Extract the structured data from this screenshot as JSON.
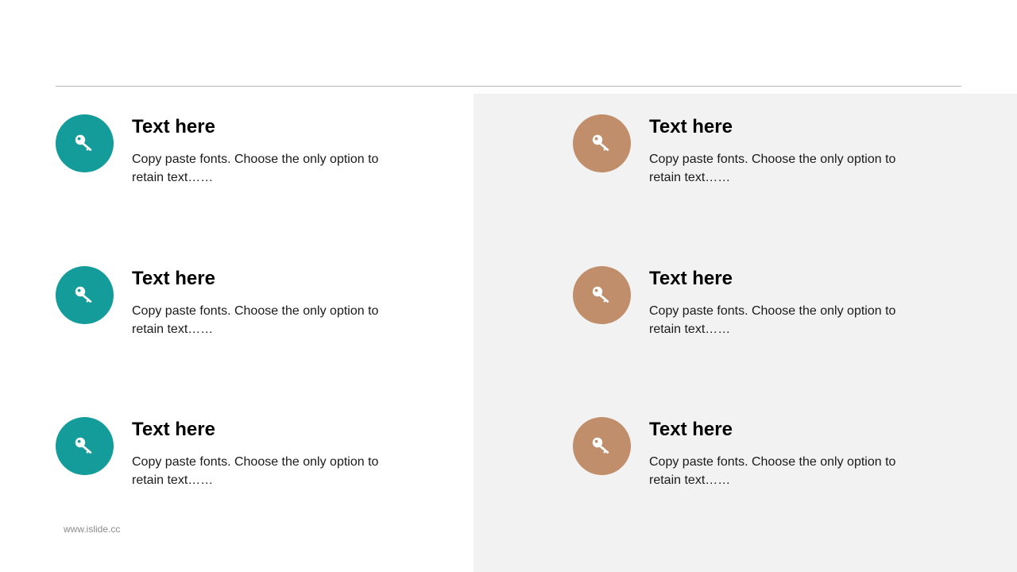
{
  "colors": {
    "teal": "#139c9a",
    "tan": "#c08e6a",
    "panel": "#f2f2f2",
    "rule": "#b3b3b3"
  },
  "left_items": [
    {
      "icon": "key-icon",
      "title": "Text here",
      "text": "Copy paste fonts. Choose the only option to retain text……"
    },
    {
      "icon": "key-icon",
      "title": "Text here",
      "text": "Copy paste fonts. Choose the only option to retain text……"
    },
    {
      "icon": "key-icon",
      "title": "Text here",
      "text": "Copy paste fonts. Choose the only option to retain text……"
    }
  ],
  "right_items": [
    {
      "icon": "key-icon",
      "title": "Text here",
      "text": "Copy paste fonts. Choose the only option to retain text……"
    },
    {
      "icon": "key-icon",
      "title": "Text here",
      "text": "Copy paste fonts. Choose the only option to retain text……"
    },
    {
      "icon": "key-icon",
      "title": "Text here",
      "text": "Copy paste fonts. Choose the only option to retain text……"
    }
  ],
  "footer": {
    "url": "www.islide.cc"
  }
}
